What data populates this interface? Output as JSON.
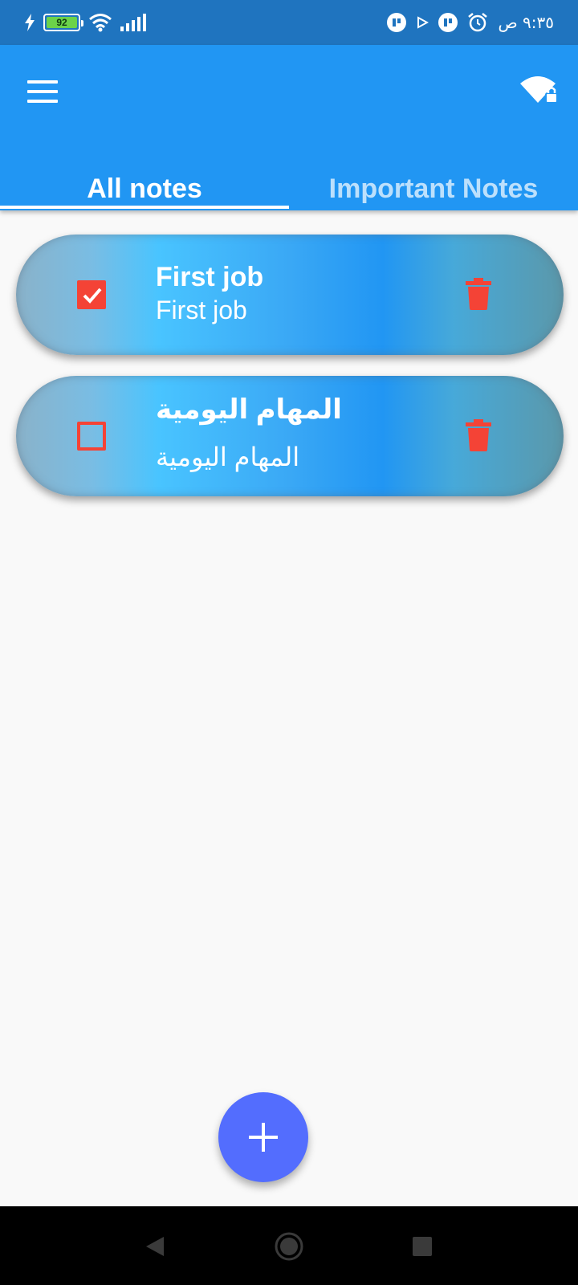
{
  "status_bar": {
    "battery_level": "92",
    "time": "٩:٣٥ ص",
    "icons": [
      "charging-icon",
      "battery-icon",
      "wifi-icon",
      "signal-icon",
      "notification-app-icon",
      "play-icon",
      "notification-app-icon",
      "alarm-icon"
    ]
  },
  "app_bar": {
    "menu_icon": "hamburger-menu-icon",
    "action_icon": "wifi-lock-icon",
    "tabs": [
      {
        "label": "All notes",
        "selected": true
      },
      {
        "label": "Important Notes",
        "selected": false
      }
    ]
  },
  "notes": [
    {
      "title": "First job",
      "subtitle": "First job",
      "checked": true,
      "delete_icon": "trash-icon"
    },
    {
      "title": "المهام اليومية",
      "subtitle": "المهام اليومية",
      "checked": false,
      "delete_icon": "trash-icon"
    }
  ],
  "fab": {
    "icon": "plus-icon"
  },
  "nav_bar": {
    "icons": [
      "back-icon",
      "home-icon",
      "recents-icon"
    ]
  },
  "colors": {
    "status_bar": "#1f74bf",
    "app_bar": "#2196f3",
    "accent_red": "#f44336",
    "fab": "#536dfe",
    "background": "#f9f9f9"
  }
}
